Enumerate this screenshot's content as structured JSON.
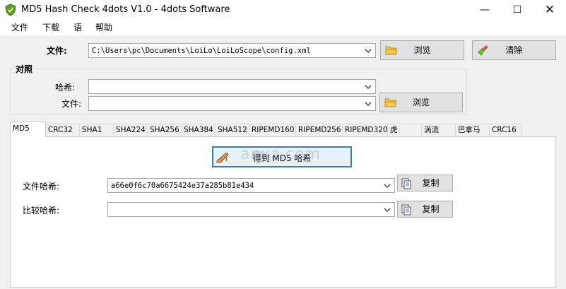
{
  "window": {
    "title": "MD5 Hash Check 4dots V1.0 - 4dots Software",
    "minimize": "—",
    "maximize": "☐",
    "close": "✕"
  },
  "menu": {
    "file": "文件",
    "download": "下载",
    "language": "语",
    "help": "帮助"
  },
  "file_row": {
    "label": "文件:",
    "value": "C:\\Users\\pc\\Documents\\LoiLo\\LoiLoScope\\config.xml",
    "browse": "浏览",
    "clear": "清除"
  },
  "compare": {
    "title": "对照",
    "hash_label": "哈希:",
    "hash_value": "",
    "file_label": "文件:",
    "file_value": "",
    "browse": "浏览"
  },
  "tabs": [
    "MD5",
    "CRC32",
    "SHA1",
    "SHA224",
    "SHA256",
    "SHA384",
    "SHA512",
    "RIPEMD160",
    "RIPEMD256",
    "RIPEMD320",
    "虎",
    "涡流",
    "巴拿马",
    "CRC16"
  ],
  "active_tab": "MD5",
  "panel": {
    "get_button": "得到 MD5 哈希",
    "file_hash_label": "文件哈希:",
    "file_hash_value": "a66e0f6c70a6675424e37a285b81e434",
    "compare_hash_label": "比较哈希:",
    "compare_hash_value": "",
    "copy": "复制"
  },
  "watermark": "anxz.com",
  "colors": {
    "accent": "#3c7fb1",
    "folder": "#f2c94c",
    "titlebar": "#ffffff",
    "background": "#f0f0f0"
  },
  "icons": [
    "app-shield-icon",
    "folder-icon",
    "broom-icon",
    "pen-icon",
    "copy-icon",
    "chevron-down-icon"
  ]
}
